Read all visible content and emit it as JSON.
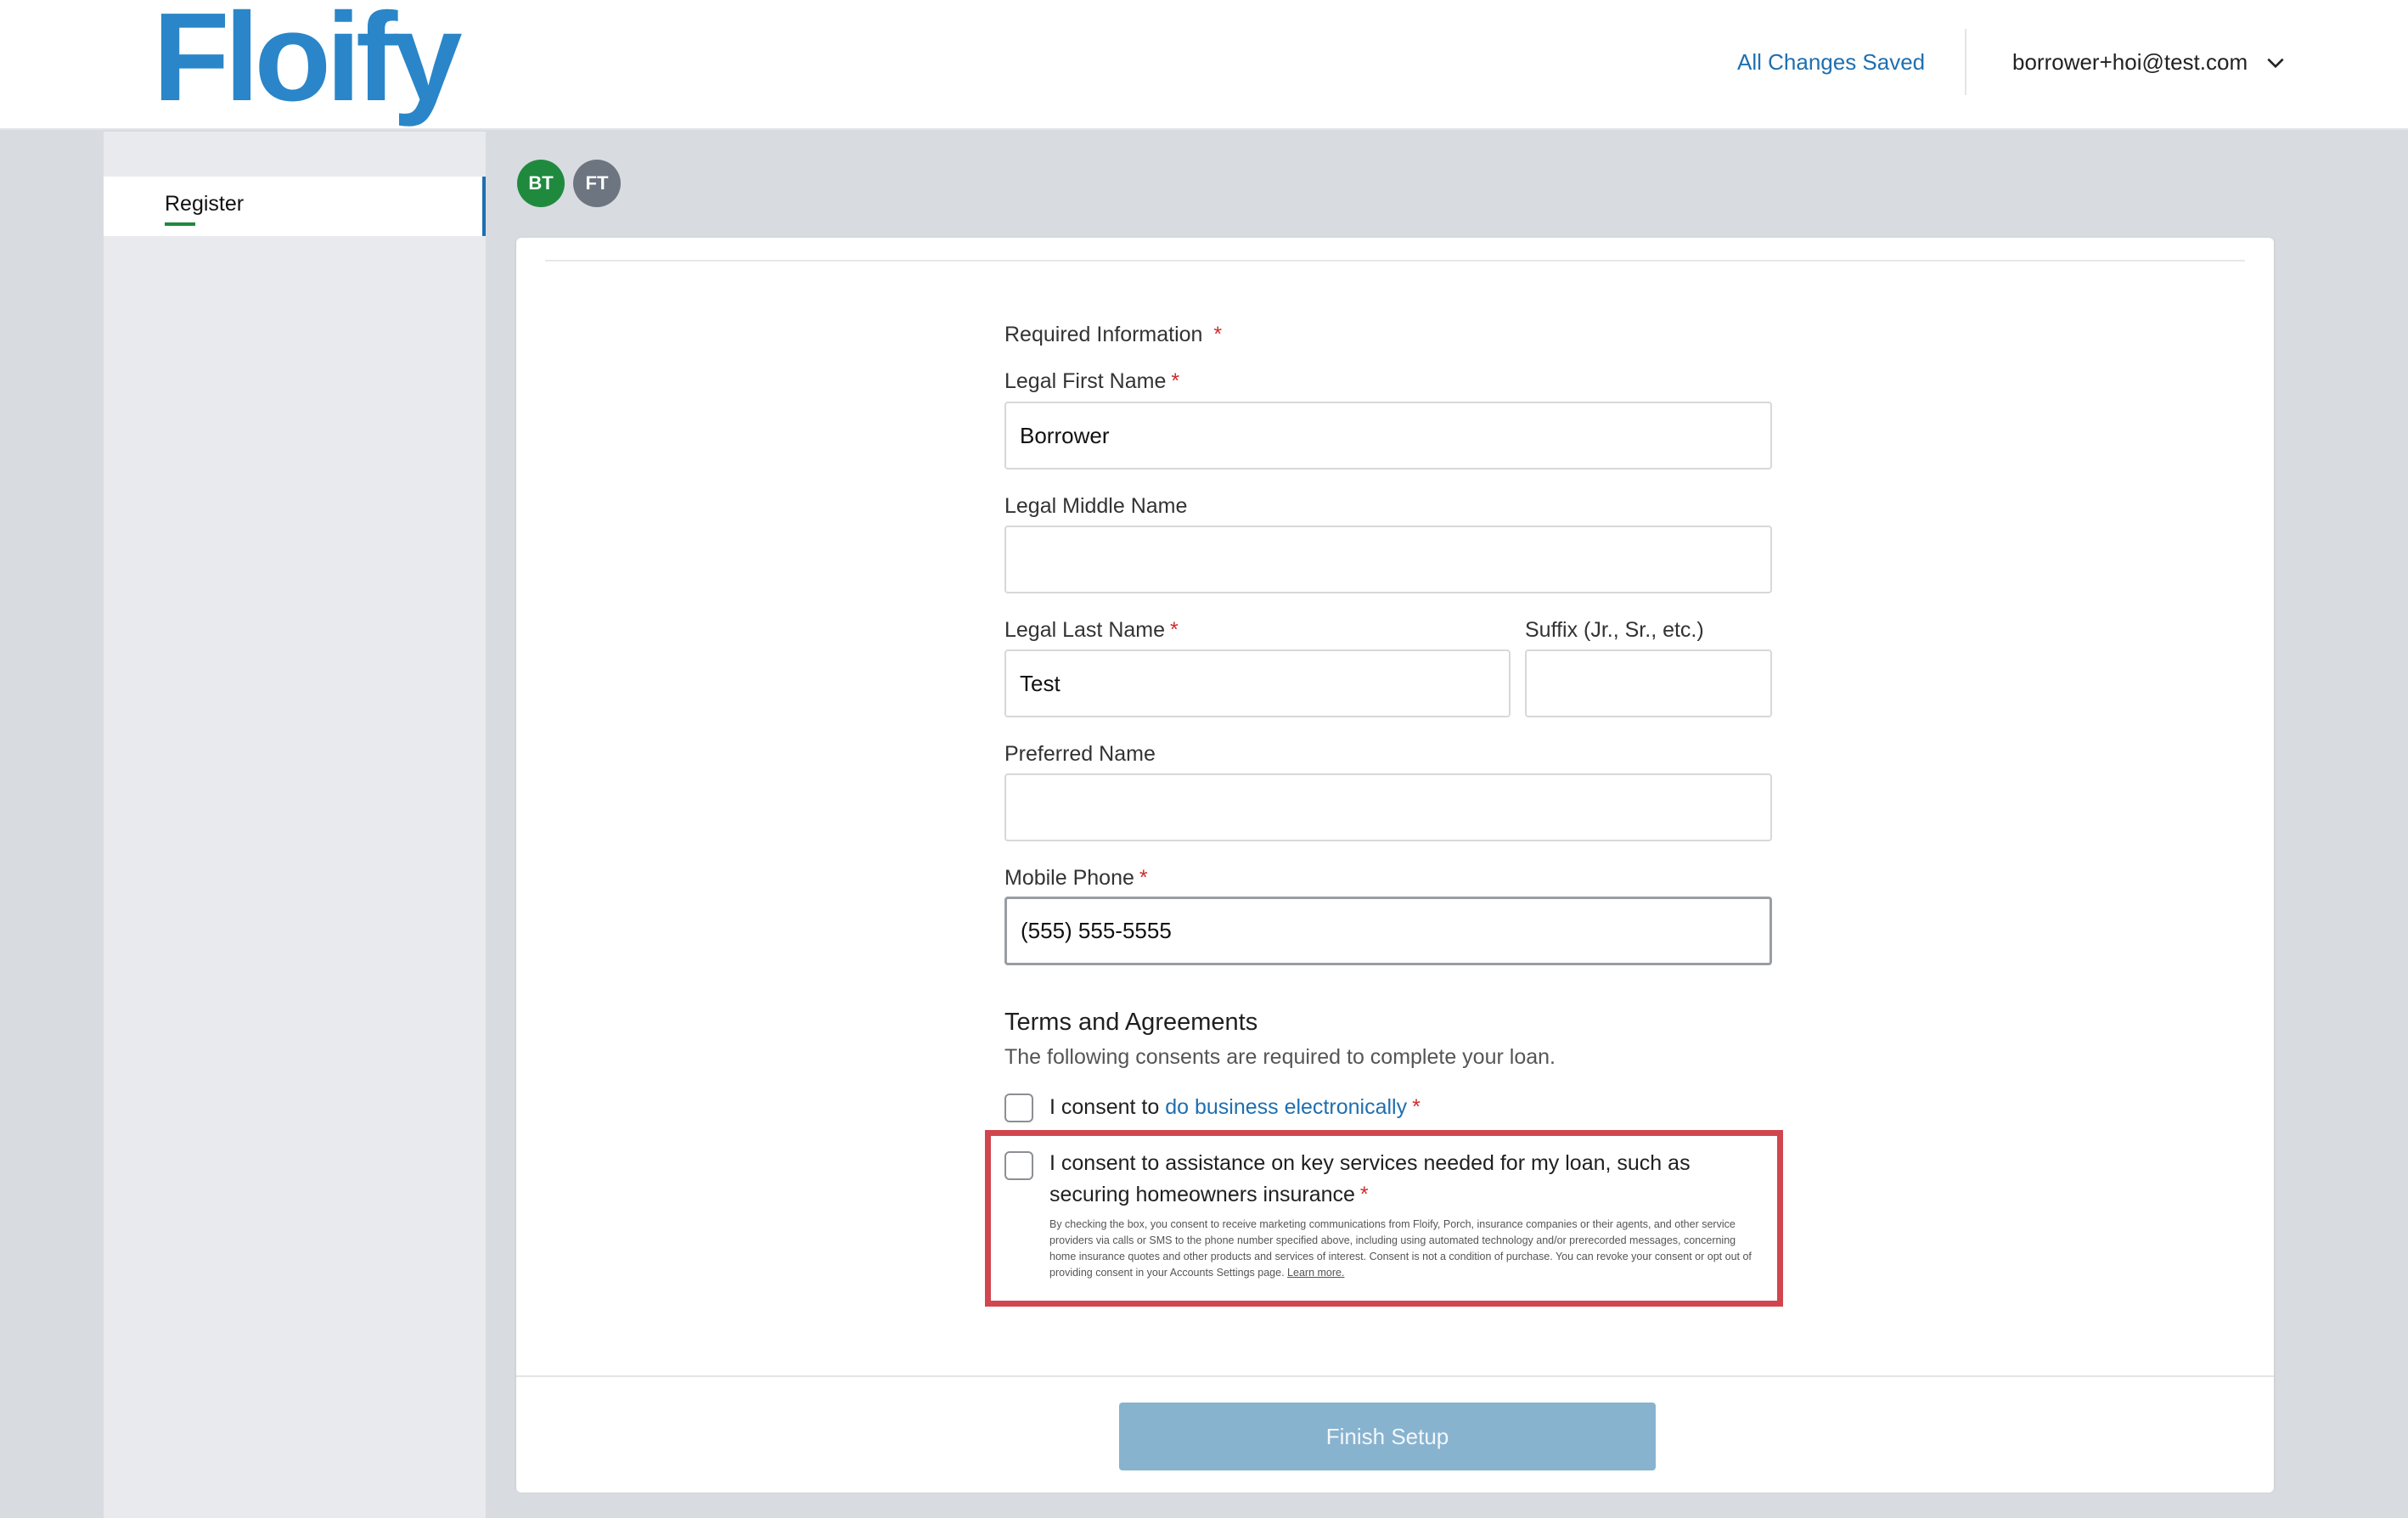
{
  "header": {
    "logo_text": "Floify",
    "save_status": "All Changes Saved",
    "user_email": "borrower+hoi@test.com"
  },
  "sidebar": {
    "items": [
      {
        "label": "Register"
      }
    ]
  },
  "avatars": [
    {
      "initials": "BT",
      "color": "#1f8a3e"
    },
    {
      "initials": "FT",
      "color": "#6d7580"
    }
  ],
  "form": {
    "required_info_label": "Required Information",
    "first_name": {
      "label": "Legal First Name",
      "value": "Borrower"
    },
    "middle_name": {
      "label": "Legal Middle Name",
      "value": ""
    },
    "last_name": {
      "label": "Legal Last Name",
      "value": "Test"
    },
    "suffix": {
      "label": "Suffix (Jr., Sr., etc.)",
      "value": ""
    },
    "preferred_name": {
      "label": "Preferred Name",
      "value": ""
    },
    "mobile_phone": {
      "label": "Mobile Phone",
      "value": "(555) 555-5555"
    },
    "required_marker": "*"
  },
  "terms": {
    "title": "Terms and Agreements",
    "subtitle": "The following consents are required to complete your loan.",
    "consent_business_prefix": "I consent to ",
    "consent_business_link": "do business electronically",
    "consent_insurance": "I consent to assistance on key services needed for my loan, such as securing homeowners insurance",
    "fine_print": "By checking the box, you consent to receive marketing communications from Floify, Porch, insurance companies or their agents, and other service providers via calls or SMS to the phone number specified above, including using automated technology and/or prerecorded messages, concerning home insurance quotes and other products and services of interest. Consent is not a condition of purchase. You can revoke your consent or opt out of providing consent in your Accounts Settings page. ",
    "learn_more": "Learn more."
  },
  "footer": {
    "finish_button": "Finish Setup"
  },
  "colors": {
    "brand": "#2a86c8",
    "link": "#1e6fb0",
    "required": "#d02b2b",
    "highlight": "#d1464e",
    "button_disabled": "#88b3cf"
  }
}
